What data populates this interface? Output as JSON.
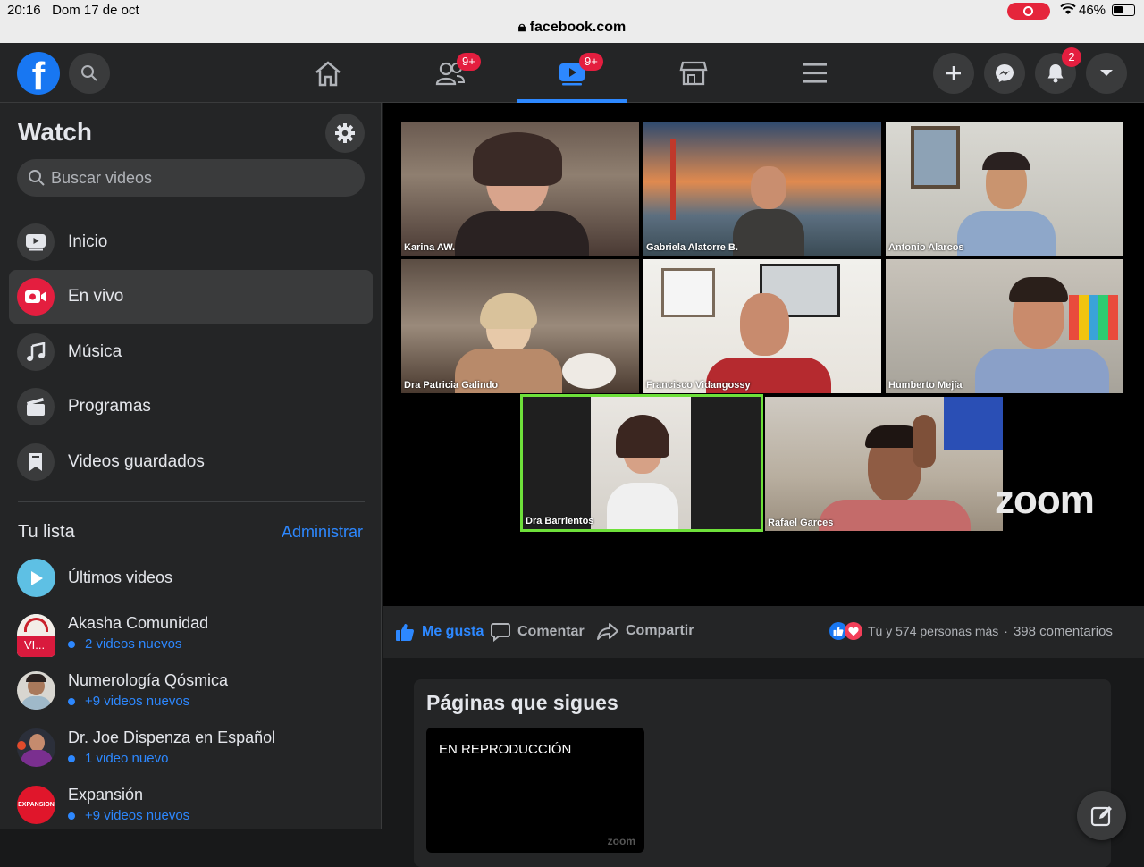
{
  "status": {
    "time": "20:16",
    "date": "Dom 17 de oct",
    "url": "facebook.com",
    "battery": "46%"
  },
  "nav": {
    "friends_badge": "9+",
    "watch_badge": "9+",
    "notif_badge": "2",
    "icons": [
      "home-icon",
      "friends-icon",
      "watch-icon",
      "marketplace-icon",
      "menu-icon"
    ],
    "active": "watch"
  },
  "sidebar": {
    "title": "Watch",
    "search_placeholder": "Buscar videos",
    "menu": [
      {
        "label": "Inicio",
        "icon": "home-video-icon"
      },
      {
        "label": "En vivo",
        "icon": "live-icon"
      },
      {
        "label": "Música",
        "icon": "music-icon"
      },
      {
        "label": "Programas",
        "icon": "clapper-icon"
      },
      {
        "label": "Videos guardados",
        "icon": "bookmark-icon"
      }
    ],
    "list_title": "Tu lista",
    "manage": "Administrar",
    "list": [
      {
        "name": "Últimos videos",
        "sub": ""
      },
      {
        "name": "Akasha Comunidad",
        "sub": "2 videos nuevos",
        "avatar_text": "VI..."
      },
      {
        "name": "Numerología Qósmica",
        "sub": "+9 videos nuevos"
      },
      {
        "name": "Dr. Joe Dispenza en Español",
        "sub": "1 video nuevo"
      },
      {
        "name": "Expansión",
        "sub": "+9 videos nuevos",
        "avatar_text": "EXPANSION"
      }
    ]
  },
  "video": {
    "participants": [
      "Karina AW.",
      "Gabriela Alatorre B.",
      "Antonio Alarcos",
      "Dra Patricia Galindo",
      "Francisco Vidangossy",
      "Humberto Mejía",
      "Dra Barrientos",
      "Rafael Garces"
    ],
    "watermark": "zoom",
    "active_speaker": "Dra Barrientos",
    "active_color": "#6ee03a"
  },
  "actions": {
    "like": "Me gusta",
    "comment": "Comentar",
    "share": "Compartir",
    "reactions_text": "Tú y 574 personas más",
    "separator": "·",
    "comments": "398 comentarios"
  },
  "pages": {
    "title": "Páginas que sigues",
    "now_playing": "EN REPRODUCCIÓN",
    "watermark": "zoom"
  },
  "colors": {
    "accent": "#2d88ff",
    "badge": "#e41e3f",
    "surface": "#242526",
    "background": "#18191a"
  }
}
